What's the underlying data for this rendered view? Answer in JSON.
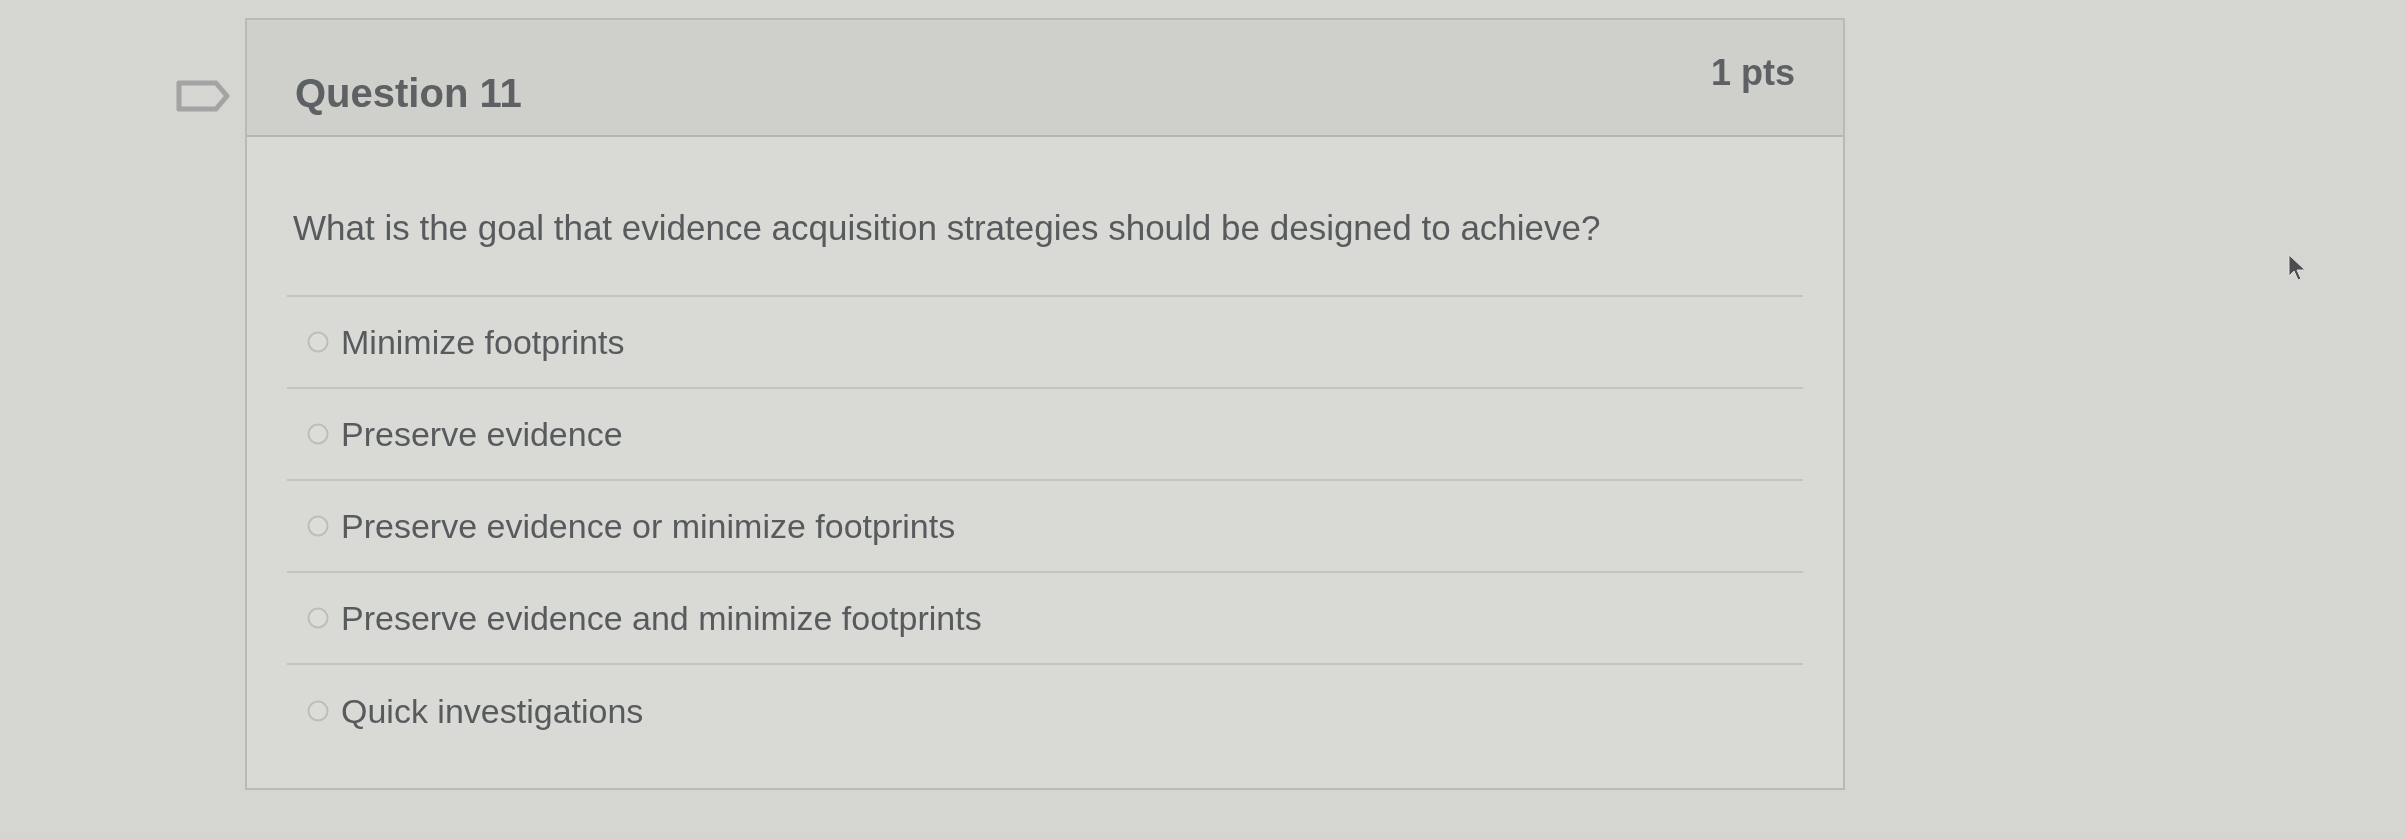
{
  "question": {
    "title": "Question 11",
    "points": "1 pts",
    "text": "What is the goal that evidence acquisition strategies should be designed to achieve?",
    "answers": [
      {
        "label": "Minimize footprints",
        "selected": false
      },
      {
        "label": "Preserve evidence",
        "selected": false
      },
      {
        "label": "Preserve evidence or minimize footprints",
        "selected": false
      },
      {
        "label": "Preserve evidence and minimize footprints",
        "selected": false
      },
      {
        "label": "Quick investigations",
        "selected": false
      }
    ]
  }
}
